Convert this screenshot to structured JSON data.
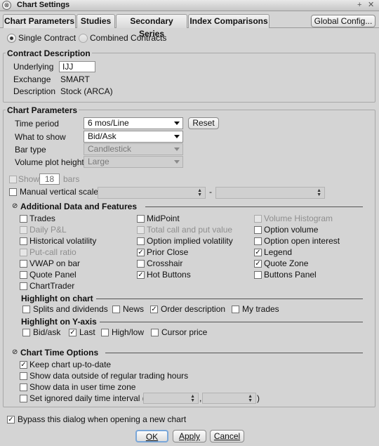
{
  "window": {
    "title": "Chart Settings",
    "icon": "app-icon",
    "controls": "+ ✕"
  },
  "tabs": [
    {
      "label": "Chart Parameters"
    },
    {
      "label": "Studies"
    },
    {
      "label": "Secondary Series"
    },
    {
      "label": "Index Comparisons"
    }
  ],
  "global_config_label": "Global Config...",
  "contract_mode": {
    "single": "Single Contract",
    "combined": "Combined Contracts"
  },
  "contract_description": {
    "title": "Contract Description",
    "underlying_label": "Underlying",
    "underlying_value": "IJJ",
    "exchange_label": "Exchange",
    "exchange_value": "SMART",
    "description_label": "Description",
    "description_value": "Stock (ARCA)"
  },
  "chart_parameters": {
    "title": "Chart Parameters",
    "time_period_label": "Time period",
    "time_period_value": "6 mos/Line",
    "reset_label": "Reset",
    "what_to_show_label": "What to show",
    "what_to_show_value": "Bid/Ask",
    "bar_type_label": "Bar type",
    "bar_type_value": "Candlestick",
    "volume_label": "Volume plot height",
    "volume_value": "Large",
    "show_label": "Show",
    "show_count": "18",
    "bars_label": "bars",
    "manual_scale_label": "Manual vertical scale",
    "dash": "-"
  },
  "additional": {
    "title": "Additional Data and Features",
    "col1": [
      "Trades",
      "Daily P&L",
      "Historical volatility",
      "Put-call ratio",
      "VWAP on bar",
      "Quote Panel",
      "ChartTrader"
    ],
    "col2": [
      "MidPoint",
      "Total call and put value",
      "Option implied volatility",
      "Prior Close",
      "Crosshair",
      "Hot Buttons"
    ],
    "col3": [
      "Volume Histogram",
      "Option volume",
      "Option open interest",
      "Legend",
      "Quote Zone",
      "Buttons Panel"
    ]
  },
  "highlight_chart": {
    "title": "Highlight on chart",
    "items": [
      "Splits and dividends",
      "News",
      "Order description",
      "My trades"
    ]
  },
  "highlight_y": {
    "title": "Highlight on Y-axis",
    "items": [
      "Bid/ask",
      "Last",
      "High/low",
      "Cursor price"
    ]
  },
  "time_options": {
    "title": "Chart Time Options",
    "items": [
      "Keep chart up-to-date",
      "Show data outside of regular trading hours",
      "Show data in user time zone",
      "Set ignored daily time interval ("
    ],
    "comma": ",",
    "close_paren": ")"
  },
  "bypass_label": "Bypass this dialog when opening a new chart",
  "buttons": {
    "ok": "OK",
    "apply": "Apply",
    "cancel": "Cancel"
  },
  "colors": {
    "dialog_bg": "#d4d4d4",
    "focus_ring": "#7aa7d9"
  }
}
